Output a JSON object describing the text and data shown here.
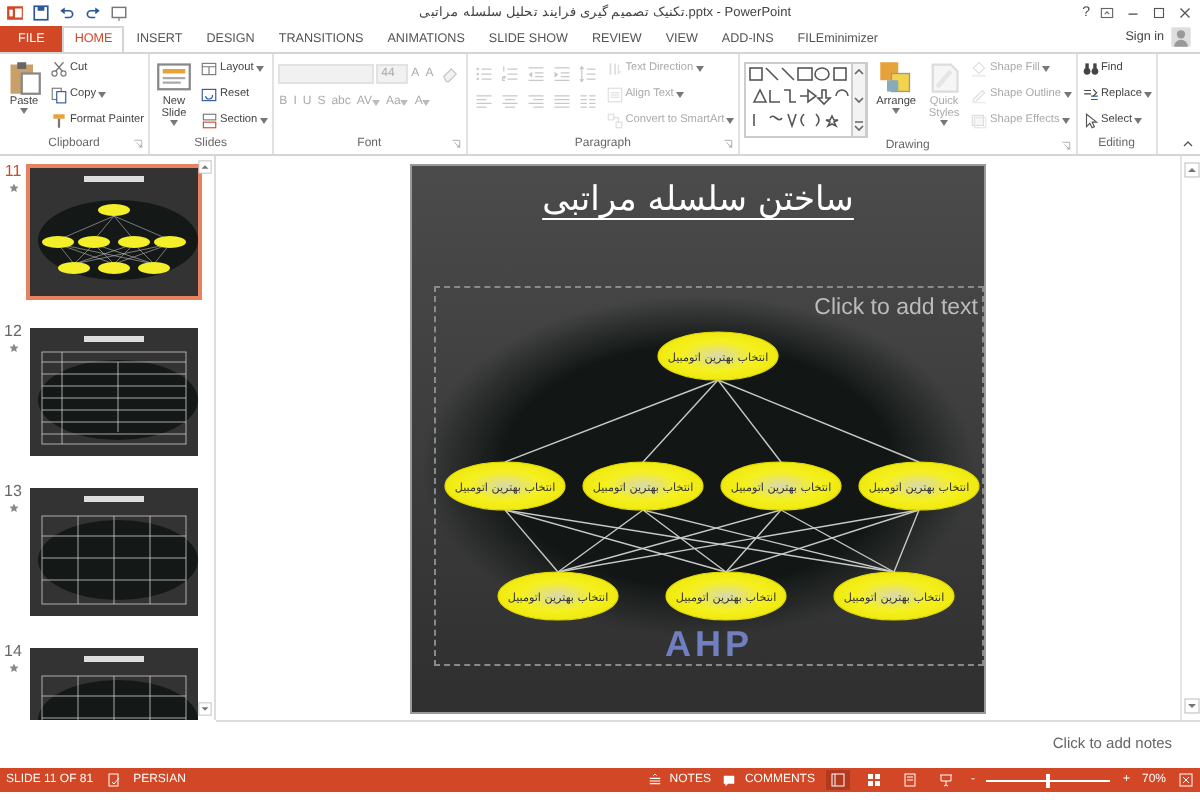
{
  "window": {
    "title": "تکنیک تصمیم گیری فرایند تحلیل سلسله مراتبی.pptx - PowerPoint",
    "help": "?",
    "account": "Sign in"
  },
  "tabs": [
    {
      "label": "FILE",
      "kind": "file",
      "selected": false
    },
    {
      "label": "HOME",
      "kind": "tab",
      "selected": true
    },
    {
      "label": "INSERT",
      "kind": "tab",
      "selected": false
    },
    {
      "label": "DESIGN",
      "kind": "tab",
      "selected": false
    },
    {
      "label": "TRANSITIONS",
      "kind": "tab",
      "selected": false
    },
    {
      "label": "ANIMATIONS",
      "kind": "tab",
      "selected": false
    },
    {
      "label": "SLIDE SHOW",
      "kind": "tab",
      "selected": false
    },
    {
      "label": "REVIEW",
      "kind": "tab",
      "selected": false
    },
    {
      "label": "VIEW",
      "kind": "tab",
      "selected": false
    },
    {
      "label": "ADD-INS",
      "kind": "tab",
      "selected": false
    },
    {
      "label": "FILEminimizer",
      "kind": "tab",
      "selected": false
    }
  ],
  "ribbon": {
    "groups": [
      {
        "label": "Clipboard",
        "launcher": true,
        "sections": [
          {
            "kind": "column",
            "items": [
              {
                "kind": "large",
                "label": "Paste",
                "dropdown": true
              }
            ]
          },
          {
            "kind": "column",
            "items": [
              {
                "kind": "small",
                "label": "Cut"
              },
              {
                "kind": "small",
                "label": "Copy",
                "dropdown": true
              },
              {
                "kind": "small",
                "label": "Format Painter"
              }
            ]
          }
        ]
      },
      {
        "label": "Slides",
        "sections": [
          {
            "kind": "column",
            "items": [
              {
                "kind": "large",
                "label": "New Slide",
                "dropdown": true
              }
            ]
          },
          {
            "kind": "column",
            "items": [
              {
                "kind": "small",
                "label": "Layout",
                "dropdown": true
              },
              {
                "kind": "small",
                "label": "Reset"
              },
              {
                "kind": "small",
                "label": "Section",
                "dropdown": true
              }
            ]
          }
        ]
      },
      {
        "label": "Font",
        "launcher": true,
        "sections": [
          {
            "kind": "toolbar",
            "lines": [
              {
                "items": [
                  {
                    "kind": "font_field",
                    "disabled": true
                  },
                  {
                    "kind": "size_field",
                    "value": "44",
                    "disabled": true
                  },
                  {
                    "kind": "glyph",
                    "label": "A",
                    "disabled": true
                  },
                  {
                    "kind": "glyph",
                    "label": "A",
                    "disabled": true
                  },
                  {
                    "kind": "icon",
                    "disabled": true
                  }
                ]
              },
              {
                "items": [
                  {
                    "kind": "glyph",
                    "label": "B",
                    "disabled": true
                  },
                  {
                    "kind": "glyph",
                    "label": "I",
                    "disabled": true
                  },
                  {
                    "kind": "glyph",
                    "label": "U",
                    "disabled": true
                  },
                  {
                    "kind": "glyph",
                    "label": "S",
                    "disabled": true
                  },
                  {
                    "kind": "glyph",
                    "label": "abc",
                    "disabled": true
                  },
                  {
                    "kind": "glyph",
                    "label": "AV",
                    "disabled": true,
                    "dropdown": true
                  },
                  {
                    "kind": "glyph",
                    "label": "Aa",
                    "disabled": true,
                    "dropdown": true
                  },
                  {
                    "kind": "glyph",
                    "label": "A",
                    "disabled": true,
                    "dropdown": true
                  }
                ]
              }
            ]
          }
        ]
      },
      {
        "label": "Paragraph",
        "launcher": true,
        "sections": [
          {
            "kind": "toolbar",
            "lines": [
              {
                "items": [
                  {
                    "kind": "icon",
                    "disabled": true
                  },
                  {
                    "kind": "icon",
                    "disabled": true
                  },
                  {
                    "kind": "icon",
                    "disabled": true
                  },
                  {
                    "kind": "icon",
                    "disabled": true
                  },
                  {
                    "kind": "icon",
                    "disabled": true
                  }
                ]
              },
              {
                "items": [
                  {
                    "kind": "icon",
                    "disabled": true
                  },
                  {
                    "kind": "icon",
                    "disabled": true
                  },
                  {
                    "kind": "icon",
                    "disabled": true
                  },
                  {
                    "kind": "icon",
                    "disabled": true
                  },
                  {
                    "kind": "icon",
                    "disabled": true
                  }
                ]
              }
            ]
          },
          {
            "kind": "column",
            "items": [
              {
                "kind": "small",
                "label": "Text Direction",
                "disabled": true,
                "dropdown": true
              },
              {
                "kind": "small",
                "label": "Align Text",
                "disabled": true,
                "dropdown": true
              },
              {
                "kind": "small",
                "label": "Convert to SmartArt",
                "disabled": true,
                "dropdown": true
              }
            ]
          }
        ]
      },
      {
        "label": "Drawing",
        "launcher": true,
        "sections": [
          {
            "kind": "column",
            "items": [
              {
                "kind": "gallery"
              }
            ]
          },
          {
            "kind": "column",
            "items": [
              {
                "kind": "large",
                "label": "Arrange",
                "dropdown": true
              }
            ]
          },
          {
            "kind": "column",
            "items": [
              {
                "kind": "large",
                "label": "Quick Styles",
                "disabled": true,
                "dropdown": true
              }
            ]
          },
          {
            "kind": "column",
            "items": [
              {
                "kind": "small",
                "label": "Shape Fill",
                "disabled": true,
                "dropdown": true
              },
              {
                "kind": "small",
                "label": "Shape Outline",
                "disabled": true,
                "dropdown": true
              },
              {
                "kind": "small",
                "label": "Shape Effects",
                "disabled": true,
                "dropdown": true
              }
            ]
          }
        ]
      },
      {
        "label": "Editing",
        "sections": [
          {
            "kind": "column",
            "items": [
              {
                "kind": "small",
                "label": "Find"
              },
              {
                "kind": "small",
                "label": "Replace",
                "dropdown": true
              },
              {
                "kind": "small",
                "label": "Select",
                "dropdown": true
              }
            ]
          }
        ]
      }
    ]
  },
  "thumbnails": [
    {
      "number": "11",
      "kind": "hierarchy",
      "selected": true
    },
    {
      "number": "12",
      "kind": "table",
      "selected": false
    },
    {
      "number": "13",
      "kind": "grid",
      "selected": false
    },
    {
      "number": "14",
      "kind": "grid",
      "selected": false
    }
  ],
  "slide": {
    "title": "ساختن سلسله مراتبی",
    "background_text": "AHP",
    "placeholder": "Click to add text",
    "levels": [
      [
        "انتخاب بهترین اتومبیل"
      ],
      [
        "انتخاب بهترین اتومبیل",
        "انتخاب بهترین اتومبیل",
        "انتخاب بهترین اتومبیل",
        "انتخاب بهترین اتومبیل"
      ],
      [
        "انتخاب بهترین اتومبیل",
        "انتخاب بهترین اتومبیل",
        "انتخاب بهترین اتومبیل"
      ]
    ]
  },
  "notes": {
    "placeholder": "Click to add notes"
  },
  "status_bar": {
    "slide_info": "SLIDE 11 OF 81",
    "language": "PERSIAN",
    "notes": "NOTES",
    "comments": "COMMENTS",
    "views": [
      {
        "kind": "normal",
        "selected": true
      },
      {
        "kind": "sorter",
        "selected": false
      },
      {
        "kind": "reading",
        "selected": false
      },
      {
        "kind": "slideshow",
        "selected": false
      }
    ],
    "zoom_out": "-",
    "zoom_in": "+",
    "zoom": {
      "level": 0.48
    },
    "zoom_text": "70%"
  }
}
